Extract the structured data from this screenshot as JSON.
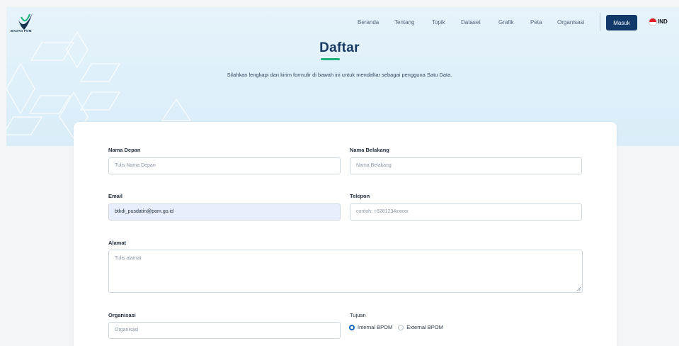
{
  "brand": {
    "name": "BADAN POM"
  },
  "nav": {
    "items": [
      "Beranda",
      "Tentang",
      "Topik",
      "Dataset",
      "Grafik",
      "Peta",
      "Organisasi"
    ],
    "login_label": "Masuk",
    "language": "IND"
  },
  "page": {
    "title": "Daftar",
    "subtitle": "Silahkan lengkapi dan kirim formulir di bawah ini untuk mendaftar sebagai pengguna Satu Data."
  },
  "form": {
    "first_name": {
      "label": "Nama Depan",
      "placeholder": "Tulis Nama Depan"
    },
    "last_name": {
      "label": "Nama Belakang",
      "placeholder": "Nama Belakang"
    },
    "email": {
      "label": "Email",
      "value": "btkdi_pusdatin@pom.go.id"
    },
    "phone": {
      "label": "Telepon",
      "placeholder": "contoh: +6281234xxxxx"
    },
    "address": {
      "label": "Alamat",
      "placeholder": "Tulis alamat"
    },
    "organization": {
      "label": "Organisasi",
      "placeholder": "Organisasi"
    },
    "purpose": {
      "label": "Tujuan",
      "options": [
        "Internal BPOM",
        "External BPOM"
      ],
      "selected": "Internal BPOM"
    }
  },
  "colors": {
    "primary": "#113a6b",
    "accent": "#19b37a",
    "radio_selected": "#1565c0",
    "flag_red": "#e11d2a"
  },
  "icons": [
    "badan-pom-logo",
    "indonesia-flag-icon",
    "textarea-resize-icon"
  ]
}
